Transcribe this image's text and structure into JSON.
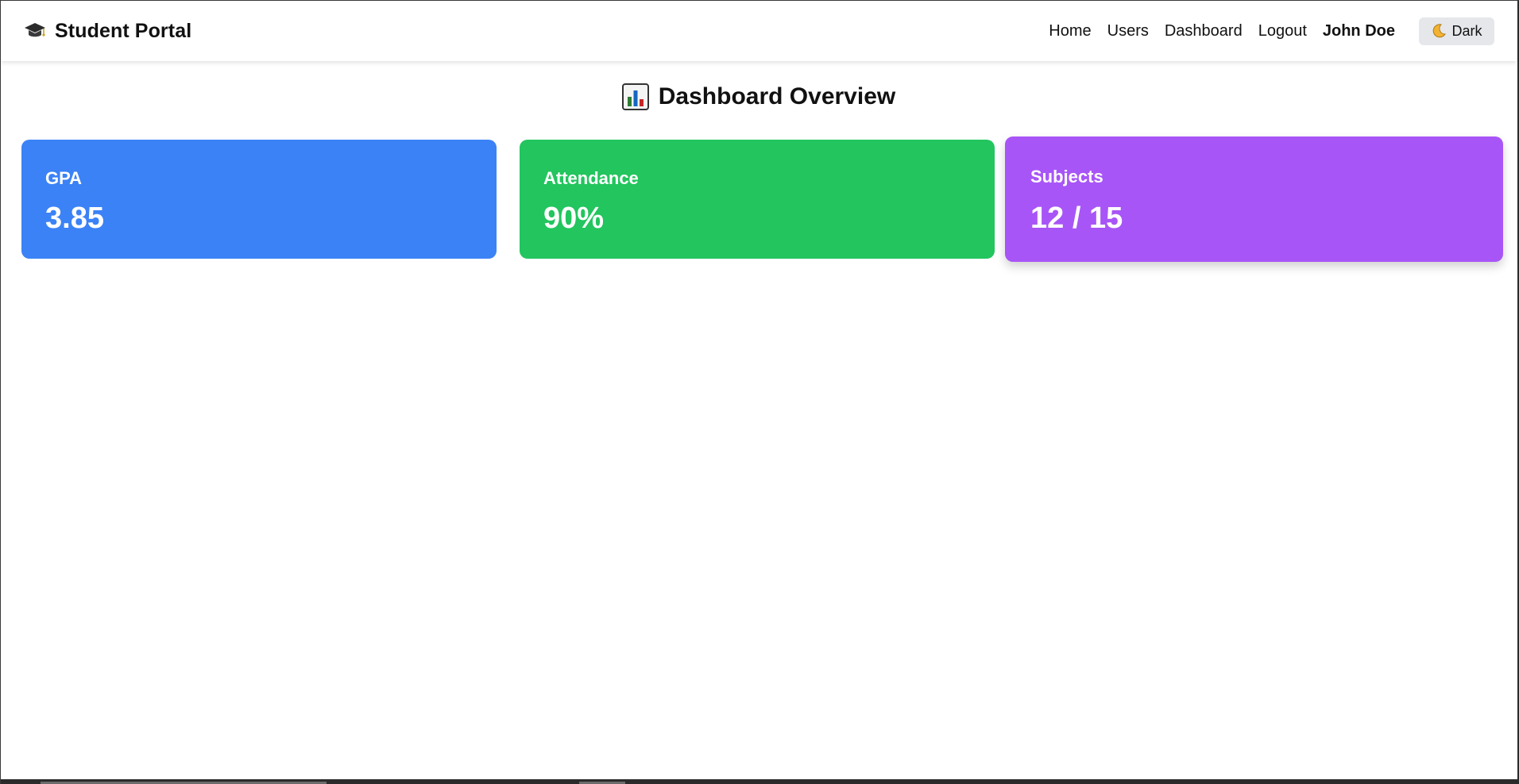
{
  "header": {
    "brand_title": "Student Portal",
    "brand_icon": "graduation-cap-icon",
    "nav": [
      "Home",
      "Users",
      "Dashboard",
      "Logout"
    ],
    "user_name": "John Doe",
    "theme_toggle": {
      "label": "Dark",
      "icon": "moon-icon"
    }
  },
  "main": {
    "title": "Dashboard Overview",
    "title_icon": "bar-chart-icon",
    "cards": [
      {
        "label": "GPA",
        "value": "3.85",
        "color": "#3b82f6"
      },
      {
        "label": "Attendance",
        "value": "90%",
        "color": "#22c55e"
      },
      {
        "label": "Subjects",
        "value": "12 / 15",
        "color": "#a855f7"
      }
    ]
  }
}
